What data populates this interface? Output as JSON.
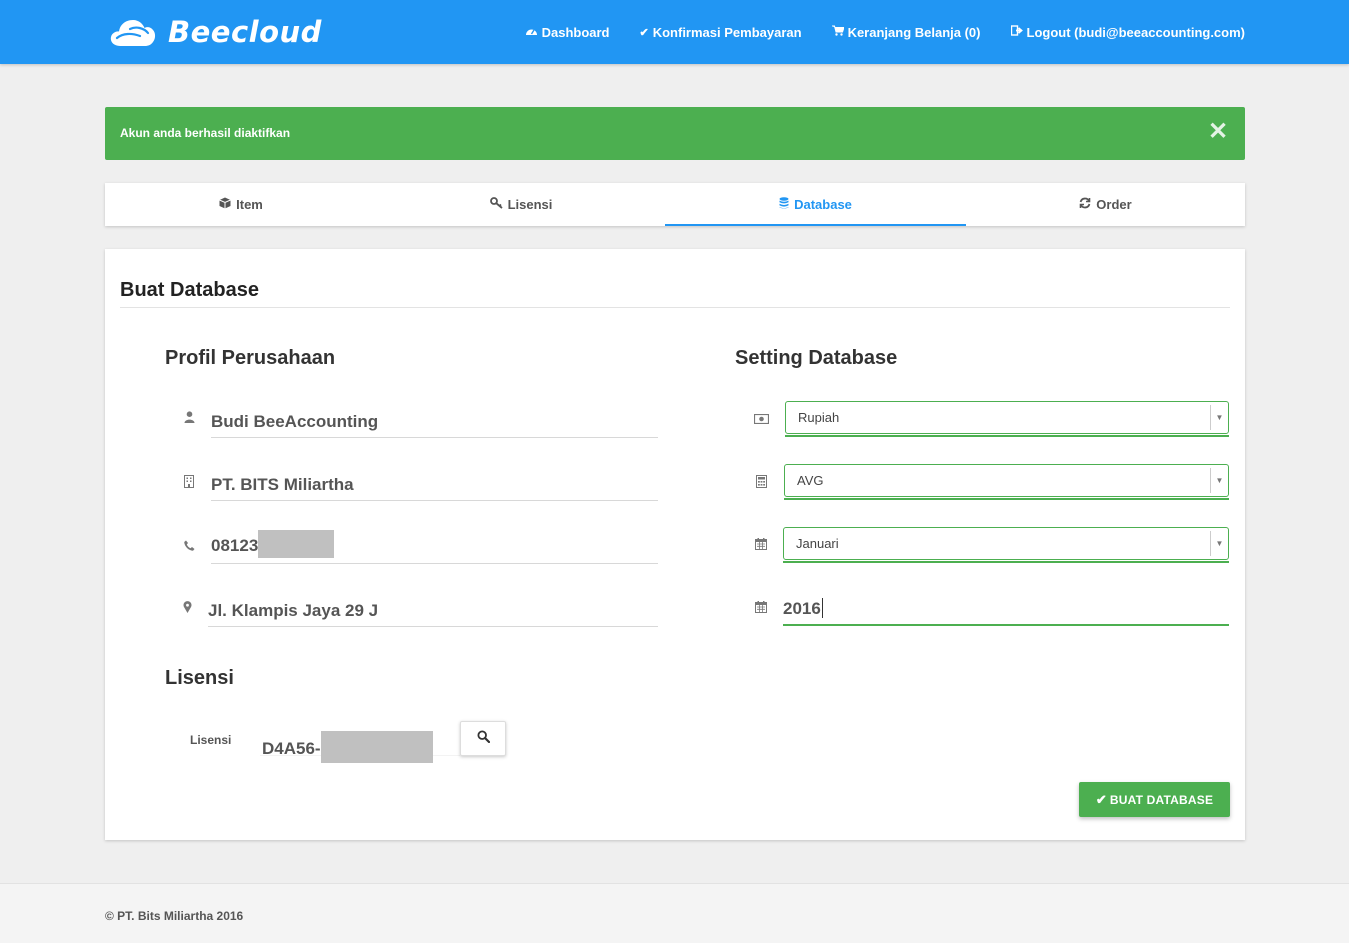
{
  "colors": {
    "primary": "#2196f3",
    "success": "#4caf50"
  },
  "header": {
    "brand": "Beecloud",
    "nav": [
      {
        "label": "Dashboard",
        "icon": "dashboard-icon"
      },
      {
        "label": "Konfirmasi Pembayaran",
        "icon": "check-icon"
      },
      {
        "label": "Keranjang Belanja (0)",
        "icon": "cart-icon"
      },
      {
        "label": "Logout (budi@beeaccounting.com)",
        "icon": "logout-icon"
      }
    ]
  },
  "alert": {
    "message": "Akun anda berhasil diaktifkan"
  },
  "tabs": [
    {
      "label": "Item",
      "icon": "cube-icon"
    },
    {
      "label": "Lisensi",
      "icon": "key-icon"
    },
    {
      "label": "Database",
      "icon": "database-icon",
      "active": true
    },
    {
      "label": "Order",
      "icon": "refresh-icon"
    }
  ],
  "card": {
    "title": "Buat Database",
    "profile": {
      "heading": "Profil Perusahaan",
      "name": "Budi BeeAccounting",
      "company": "PT. BITS Miliartha",
      "phone": "08123",
      "address": "Jl. Klampis Jaya 29 J"
    },
    "settings": {
      "heading": "Setting Database",
      "currency": "Rupiah",
      "method": "AVG",
      "month": "Januari",
      "year": "2016"
    },
    "license": {
      "heading": "Lisensi",
      "label": "Lisensi",
      "value": "D4A56-"
    },
    "submit_label": "BUAT DATABASE"
  },
  "footer": {
    "text": "© PT. Bits Miliartha 2016"
  }
}
